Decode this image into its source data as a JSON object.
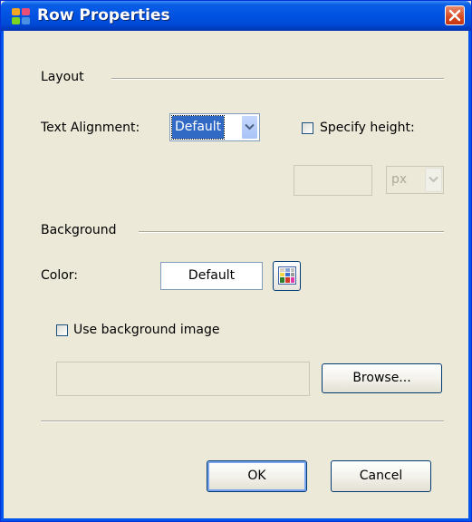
{
  "window": {
    "title": "Row Properties"
  },
  "layout_section": {
    "heading": "Layout",
    "text_alignment_label": "Text Alignment:",
    "text_alignment_value": "Default",
    "specify_height_label": "Specify height:",
    "specify_height_checked": false,
    "height_value": "",
    "height_unit": "px"
  },
  "background_section": {
    "heading": "Background",
    "color_label": "Color:",
    "color_value": "Default",
    "use_image_label": "Use background image",
    "use_image_checked": false,
    "image_path": "",
    "browse_label": "Browse..."
  },
  "buttons": {
    "ok_label": "OK",
    "cancel_label": "Cancel"
  },
  "colors": {
    "titlebar": "#0054e3",
    "dialog_bg": "#ece9d8",
    "selection": "#316ac5"
  }
}
